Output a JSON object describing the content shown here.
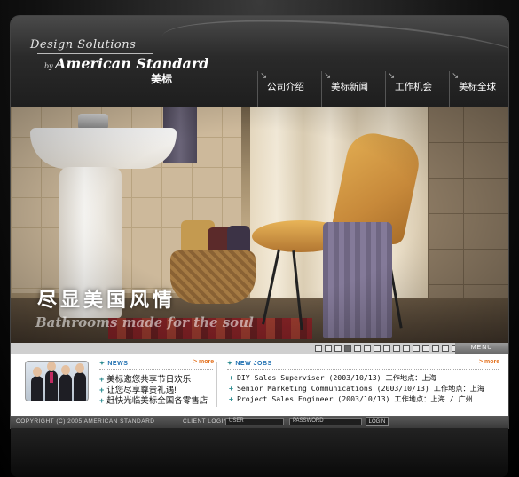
{
  "brand": {
    "script": "Design Solutions",
    "by": "by",
    "name": "American Standard",
    "cn": "美标"
  },
  "nav": {
    "items": [
      {
        "label": "公司介绍"
      },
      {
        "label": "美标新闻"
      },
      {
        "label": "工作机会"
      },
      {
        "label": "美标全球"
      }
    ]
  },
  "banner": {
    "title": "尽显美国风情",
    "subtitle": "Bathrooms made for the soul"
  },
  "strip": {
    "menu_label": "MENU",
    "thumb_count": 15,
    "active_index": 3
  },
  "news": {
    "heading": "NEWS",
    "more": "> more",
    "items": [
      "美标邀您共享节日欢乐",
      "让您尽享尊贵礼遇!",
      "赶快光临美标全国各零售店"
    ]
  },
  "jobs": {
    "heading": "NEW JOBS",
    "more": "> more",
    "items": [
      "DIY Sales Superviser (2003/10/13) 工作地点：上海",
      "Senior Marketing Communications  (2003/10/13) 工作地点：上海",
      "Project Sales Engineer (2003/10/13) 工作地点：上海 / 广州"
    ]
  },
  "footer": {
    "copyright": "COPYRIGHT (C) 2005 AMERICAN STANDARD",
    "client_login": "CLIENT LOGIN:",
    "user_placeholder": "USER",
    "password_placeholder": "PASSWORD",
    "login_button": "LOGIN"
  },
  "colors": {
    "accent_teal": "#2a8b8f",
    "accent_orange": "#e3701c",
    "heading_blue": "#1e6fb0"
  }
}
